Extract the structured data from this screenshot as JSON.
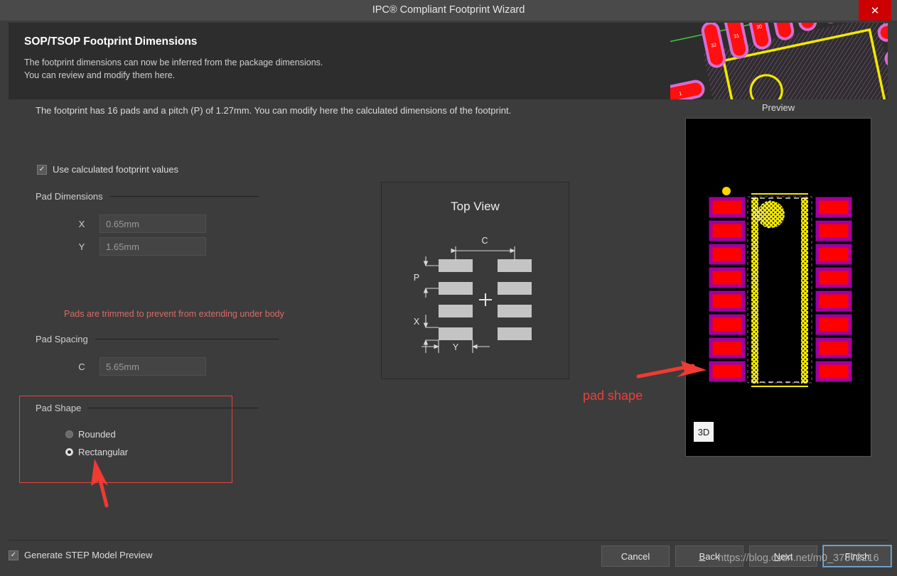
{
  "window": {
    "title": "IPC® Compliant Footprint Wizard",
    "close_icon": "close-icon",
    "close_glyph": "✕"
  },
  "header": {
    "title": "SOP/TSOP Footprint Dimensions",
    "subtitle_line1": "The footprint dimensions can now be inferred from the package dimensions.",
    "subtitle_line2": "You can review and modify them here."
  },
  "body": {
    "intro": "The footprint has 16 pads and a pitch (P) of 1.27mm. You can modify here the calculated dimensions of the footprint.",
    "use_calculated": {
      "label": "Use calculated footprint values",
      "checked": true,
      "check_glyph": "✓"
    },
    "pad_dimensions": {
      "section_label": "Pad Dimensions",
      "fields": [
        {
          "name": "X",
          "value": "0.65mm"
        },
        {
          "name": "Y",
          "value": "1.65mm"
        }
      ]
    },
    "warning": "Pads are trimmed to prevent from extending under body",
    "pad_spacing": {
      "section_label": "Pad Spacing",
      "fields": [
        {
          "name": "C",
          "value": "5.65mm"
        }
      ]
    },
    "pad_shape": {
      "section_label": "Pad Shape",
      "options": [
        {
          "label": "Rounded",
          "selected": false
        },
        {
          "label": "Rectangular",
          "selected": true
        }
      ],
      "highlight_color": "#e8413c"
    }
  },
  "diagram": {
    "title": "Top View",
    "labels": {
      "c": "C",
      "p": "P",
      "x": "X",
      "y": "Y",
      "center": "+"
    }
  },
  "preview": {
    "label": "Preview",
    "button_3d": "3D",
    "pad_count": 16,
    "pads_per_side": 8,
    "colors": {
      "pad_fill": "#ff0000",
      "pad_outline": "#a000a0",
      "silkscreen": "#ffd400",
      "background": "#000000"
    }
  },
  "annotations": {
    "pad_shape_text": "pad shape",
    "color": "#e8413c"
  },
  "footer": {
    "generate_step": {
      "label": "Generate STEP Model Preview",
      "checked": true,
      "check_glyph": "✓"
    },
    "buttons": [
      {
        "label": "Cancel",
        "accel": "",
        "focused": false
      },
      {
        "label": "Back",
        "accel": "B",
        "focused": false
      },
      {
        "label": "Next",
        "accel": "N",
        "focused": false
      },
      {
        "label": "Finish",
        "accel": "",
        "focused": true
      }
    ]
  },
  "watermark": "https://blog.csdn.net/m0_37872216"
}
